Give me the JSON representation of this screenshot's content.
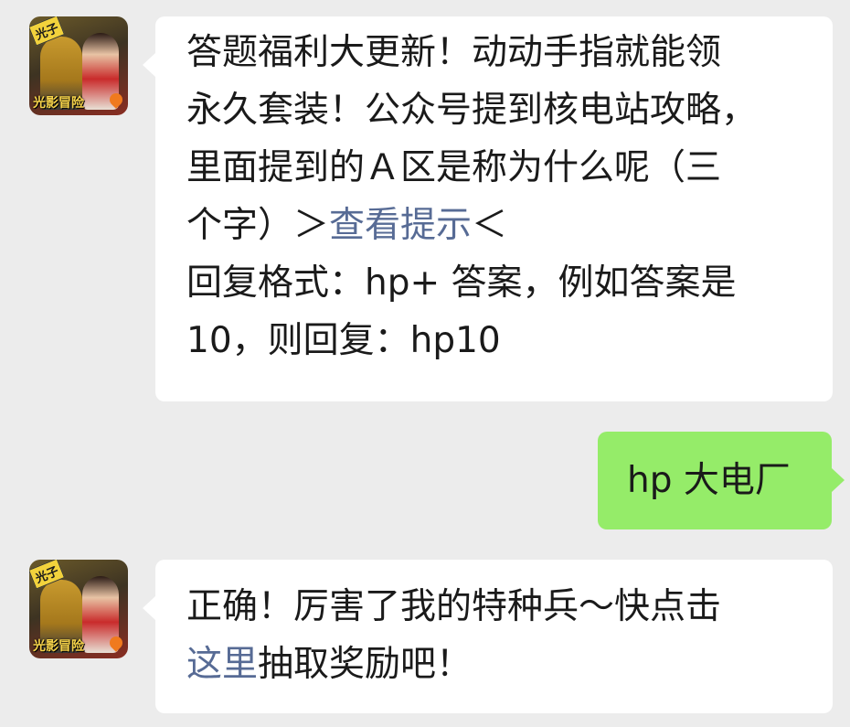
{
  "colors": {
    "background": "#ececec",
    "incoming_bubble": "#ffffff",
    "outgoing_bubble": "#95ec69",
    "link": "#576b95"
  },
  "avatar": {
    "icon": "game-avatar-icon",
    "tag_text": "光子",
    "brand_text": "光影冒险"
  },
  "messages": [
    {
      "side": "incoming",
      "lines": [
        "答题福利大更新！动动手指就能领",
        "永久套装！公众号提到核电站攻略，",
        "里面提到的Ａ区是称为什么呢（三"
      ],
      "line4_prefix": "个字）＞",
      "line4_link": "查看提示",
      "line4_suffix": "＜",
      "line5": "回复格式：hp+ 答案，例如答案是",
      "line6": "10，则回复：hp10"
    },
    {
      "side": "outgoing",
      "text": "hp 大电厂"
    },
    {
      "side": "incoming",
      "line1": "正确！厉害了我的特种兵～快点击",
      "line2_link": "这里",
      "line2_suffix": "抽取奖励吧！"
    }
  ]
}
